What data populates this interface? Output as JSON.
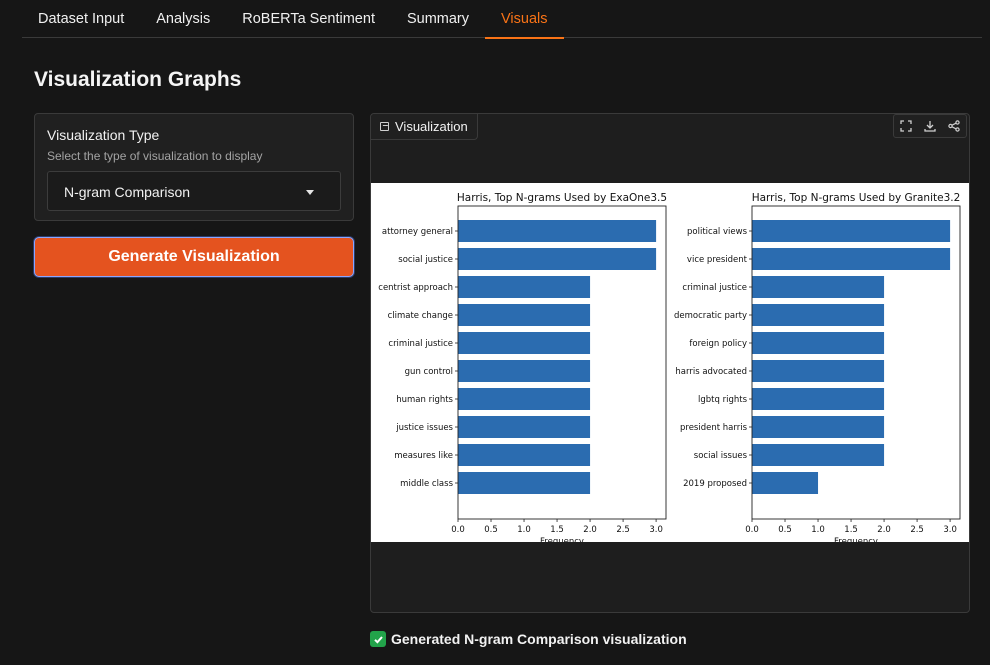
{
  "tabs": [
    {
      "label": "Dataset Input",
      "active": false
    },
    {
      "label": "Analysis",
      "active": false
    },
    {
      "label": "RoBERTa Sentiment",
      "active": false
    },
    {
      "label": "Summary",
      "active": false
    },
    {
      "label": "Visuals",
      "active": true
    }
  ],
  "page_title": "Visualization Graphs",
  "viz_type": {
    "label": "Visualization Type",
    "info": "Select the type of visualization to display",
    "selected": "N-gram Comparison"
  },
  "generate_button": "Generate Visualization",
  "viz_panel": {
    "label": "Visualization",
    "tools": [
      "fullscreen-icon",
      "download-icon",
      "share-icon"
    ]
  },
  "status": "Generated N-gram Comparison visualization",
  "colors": {
    "accent": "#f97316",
    "button": "#e4531f",
    "bar": "#2b6cb0",
    "check": "#22a34a"
  },
  "chart_data": [
    {
      "type": "bar",
      "orientation": "horizontal",
      "title": "Harris, Top N-grams Used by ExaOne3.5",
      "xlabel": "Frequency",
      "categories": [
        "attorney general",
        "social justice",
        "centrist approach",
        "climate change",
        "criminal justice",
        "gun control",
        "human rights",
        "justice issues",
        "measures like",
        "middle class"
      ],
      "values": [
        3,
        3,
        2,
        2,
        2,
        2,
        2,
        2,
        2,
        2
      ],
      "xlim": [
        0,
        3.15
      ],
      "xticks": [
        "0.0",
        "0.5",
        "1.0",
        "1.5",
        "2.0",
        "2.5",
        "3.0"
      ]
    },
    {
      "type": "bar",
      "orientation": "horizontal",
      "title": "Harris, Top N-grams Used by Granite3.2",
      "xlabel": "Frequency",
      "categories": [
        "political views",
        "vice president",
        "criminal justice",
        "democratic party",
        "foreign policy",
        "harris advocated",
        "lgbtq rights",
        "president harris",
        "social issues",
        "2019 proposed"
      ],
      "values": [
        3,
        3,
        2,
        2,
        2,
        2,
        2,
        2,
        2,
        1
      ],
      "xlim": [
        0,
        3.15
      ],
      "xticks": [
        "0.0",
        "0.5",
        "1.0",
        "1.5",
        "2.0",
        "2.5",
        "3.0"
      ]
    }
  ]
}
